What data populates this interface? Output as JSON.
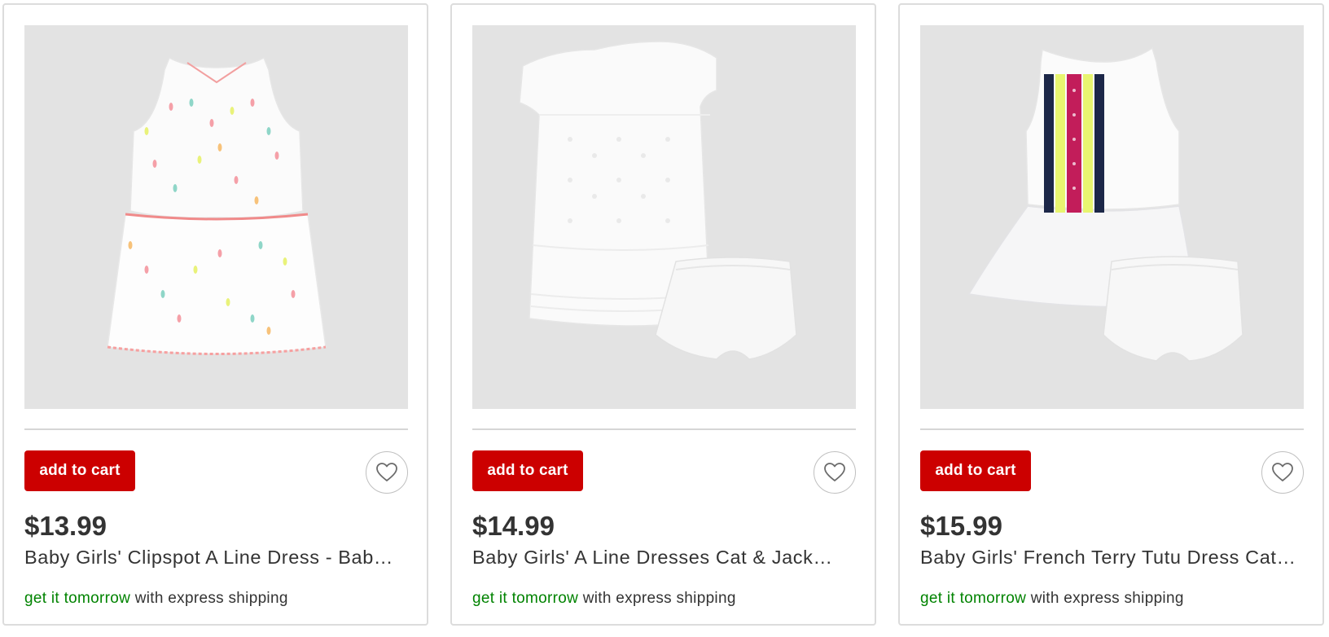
{
  "products": [
    {
      "image_alt": "white sleeveless dress with multicolor dots and pink trim",
      "add_to_cart": "add to cart",
      "favorite_icon": "heart-outline-icon",
      "price": "$13.99",
      "title": "Baby Girls' Clipspot A Line Dress - Bab…",
      "shipping_highlight": "get it tomorrow",
      "shipping_rest": " with express shipping"
    },
    {
      "image_alt": "white eyelet short-sleeve dress with bloomers",
      "add_to_cart": "add to cart",
      "favorite_icon": "heart-outline-icon",
      "price": "$14.99",
      "title": "Baby Girls' A Line Dresses Cat & Jack…",
      "shipping_highlight": "get it tomorrow",
      "shipping_rest": " with express shipping"
    },
    {
      "image_alt": "white tutu dress with colorful ribbon trim and bloomers",
      "add_to_cart": "add to cart",
      "favorite_icon": "heart-outline-icon",
      "price": "$15.99",
      "title": "Baby Girls' French Terry Tutu Dress Cat…",
      "shipping_highlight": "get it tomorrow",
      "shipping_rest": " with express shipping"
    }
  ],
  "colors": {
    "brand_red": "#cc0000",
    "shipping_green": "#008300",
    "text": "#333333",
    "image_bg": "#e3e3e3",
    "border": "#dcdcdc"
  }
}
